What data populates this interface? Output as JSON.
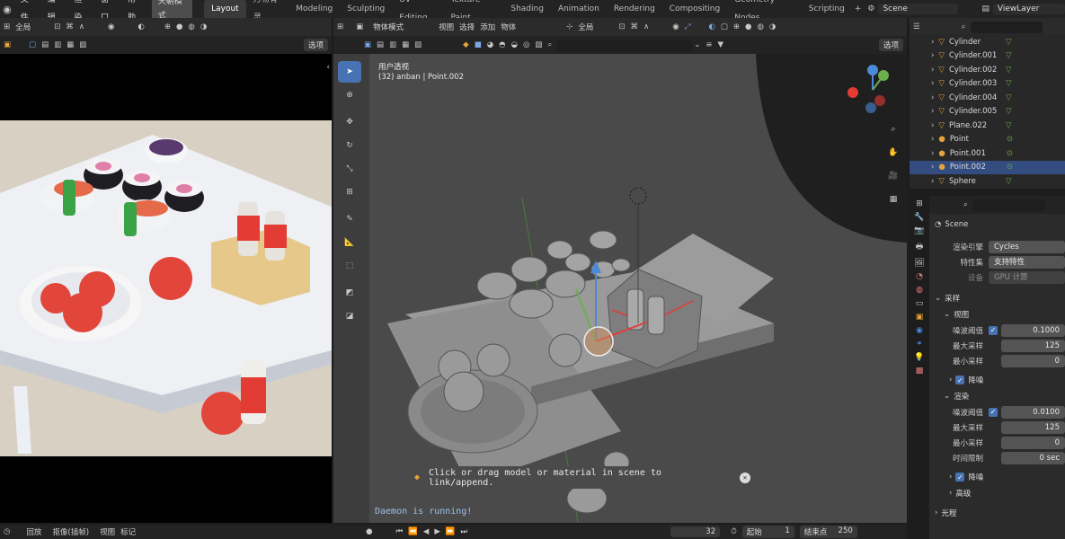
{
  "topbar": {
    "menus": [
      "文件",
      "编辑",
      "渲染",
      "窗口",
      "帮助"
    ],
    "active_menu": "天朝模式",
    "tabs": [
      "Layout",
      "万物有灵",
      "Modeling",
      "Sculpting",
      "UV Editing",
      "Texture Paint",
      "Shading",
      "Animation",
      "Rendering",
      "Compositing",
      "Geometry Nodes",
      "Scripting"
    ],
    "active_tab": "Layout",
    "plus": "+",
    "scene": "Scene",
    "viewlayer": "ViewLayer"
  },
  "left_view": {
    "header": {
      "mode": "全局",
      "select": "选项"
    }
  },
  "main_view": {
    "header": {
      "mode": "物体模式",
      "menu": [
        "视图",
        "选择",
        "添加",
        "物体"
      ],
      "orientation": "全局",
      "options": "选项"
    },
    "overlay_title": "用户透视",
    "overlay_sub": "(32) anban | Point.002",
    "toast": "Click or drag model or material in scene to link/append.",
    "daemon": "Daemon is running!"
  },
  "outliner": {
    "items": [
      {
        "name": "Cylinder",
        "type": "mesh"
      },
      {
        "name": "Cylinder.001",
        "type": "mesh"
      },
      {
        "name": "Cylinder.002",
        "type": "mesh"
      },
      {
        "name": "Cylinder.003",
        "type": "mesh"
      },
      {
        "name": "Cylinder.004",
        "type": "mesh"
      },
      {
        "name": "Cylinder.005",
        "type": "mesh"
      },
      {
        "name": "Plane.022",
        "type": "mesh"
      },
      {
        "name": "Point",
        "type": "light"
      },
      {
        "name": "Point.001",
        "type": "light"
      },
      {
        "name": "Point.002",
        "type": "light",
        "selected": true
      },
      {
        "name": "Sphere",
        "type": "mesh"
      }
    ]
  },
  "properties": {
    "scene_label": "Scene",
    "render_engine_label": "渲染引擎",
    "render_engine": "Cycles",
    "feature_label": "特性集",
    "feature": "支持特性",
    "device_label": "设备",
    "device": "GPU 计算",
    "sampling": "采样",
    "viewport": "视图",
    "vp_noise_label": "噪波阈值",
    "vp_noise": "0.1000",
    "vp_max_label": "最大采样",
    "vp_max": "125",
    "vp_min_label": "最小采样",
    "vp_min": "0",
    "vp_denoise": "降噪",
    "render": "渲染",
    "r_noise_label": "噪波阈值",
    "r_noise": "0.0100",
    "r_max_label": "最大采样",
    "r_max": "125",
    "r_min_label": "最小采样",
    "r_min": "0",
    "r_time_label": "时间限制",
    "r_time": "0 sec",
    "r_denoise": "降噪",
    "advanced": "高级",
    "lightpaths": "光程"
  },
  "timeline": {
    "menus": [
      "回放",
      "抠像(插帧)",
      "视图",
      "标记"
    ],
    "current_frame": "32",
    "start_label": "起始",
    "start": "1",
    "end_label": "结束点",
    "end": "250"
  },
  "colors": {
    "accent": "#4772b3",
    "selected_row": "#334d80",
    "header": "#2b2b2b",
    "viewport_bg": "#3d3d3d"
  }
}
